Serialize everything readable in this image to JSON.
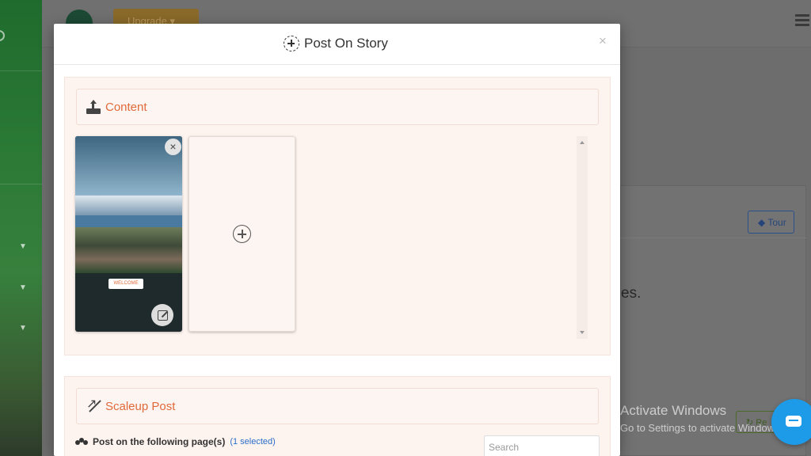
{
  "background": {
    "topbar": {
      "upgrade_label": "Upgrade ▾"
    },
    "card": {
      "tour_label": "Tour",
      "partial_text": "es.",
      "green_button_label": "Re"
    },
    "watermark": {
      "line1": "Activate Windows",
      "line2": "Go to Settings to activate Windows."
    }
  },
  "modal": {
    "title": "Post On Story",
    "close_glyph": "×",
    "content_section": {
      "label": "Content",
      "story_items": [
        {
          "type": "image",
          "remove_glyph": "×",
          "tag_text": "WELCOME"
        }
      ],
      "add_card": "add-story"
    },
    "scaleup_section": {
      "label": "Scaleup Post",
      "pages_label": "Post on the following page(s)",
      "selected_text": "(1 selected)",
      "search_placeholder": "Search"
    }
  },
  "colors": {
    "accent": "#e06a3a",
    "section_bg": "#fdf3ef",
    "link": "#2a6ec8",
    "chat": "#1e9be8"
  }
}
